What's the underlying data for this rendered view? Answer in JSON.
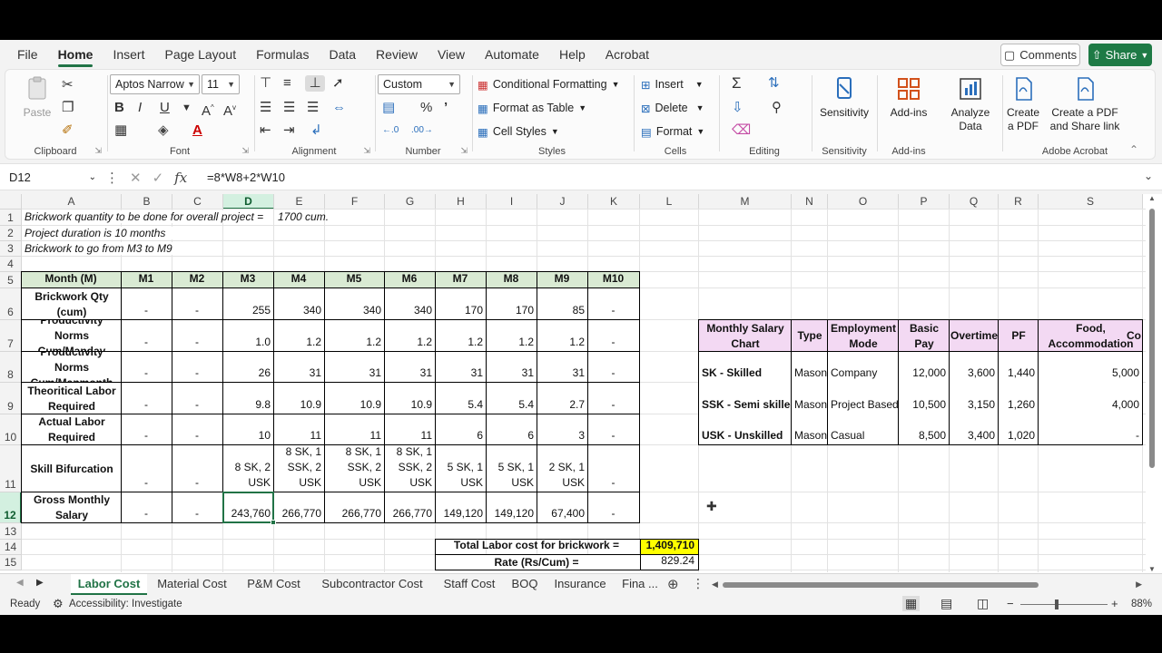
{
  "menu": {
    "items": [
      "File",
      "Home",
      "Insert",
      "Page Layout",
      "Formulas",
      "Data",
      "Review",
      "View",
      "Automate",
      "Help",
      "Acrobat"
    ],
    "active": "Home",
    "comments": "Comments",
    "share": "Share"
  },
  "ribbon": {
    "clipboard": {
      "paste": "Paste",
      "label": "Clipboard"
    },
    "font": {
      "name": "Aptos Narrow",
      "size": "11",
      "label": "Font"
    },
    "alignment": {
      "label": "Alignment"
    },
    "number": {
      "format": "Custom",
      "label": "Number"
    },
    "styles": {
      "conditional": "Conditional Formatting",
      "table": "Format as Table",
      "cell": "Cell Styles",
      "label": "Styles"
    },
    "cells": {
      "insert": "Insert",
      "delete": "Delete",
      "format": "Format",
      "label": "Cells"
    },
    "editing": {
      "label": "Editing"
    },
    "sensitivity": {
      "button": "Sensitivity",
      "label": "Sensitivity"
    },
    "addins": {
      "button": "Add-ins",
      "label": "Add-ins"
    },
    "analyze": {
      "line1": "Analyze",
      "line2": "Data"
    },
    "acrobat": {
      "pdf1": "Create",
      "pdf2": "a PDF",
      "share1": "Create a PDF",
      "share2": "and Share link",
      "label": "Adobe Acrobat"
    }
  },
  "formula_bar": {
    "cell": "D12",
    "formula": "=8*W8+2*W10"
  },
  "columns": [
    "A",
    "B",
    "C",
    "D",
    "E",
    "F",
    "G",
    "H",
    "I",
    "J",
    "K",
    "L",
    "M",
    "N",
    "O",
    "P",
    "Q",
    "R",
    "S"
  ],
  "rows": [
    "1",
    "2",
    "3",
    "4",
    "5",
    "6",
    "7",
    "8",
    "9",
    "10",
    "11",
    "12",
    "13",
    "14",
    "15"
  ],
  "notes": {
    "r1": "Brickwork quantity to be done for overall project =",
    "r1v": "1700 cum.",
    "r2": "Project duration is 10 months",
    "r3": "Brickwork to go from M3 to M9"
  },
  "table": {
    "header": [
      "Month (M)",
      "M1",
      "M2",
      "M3",
      "M4",
      "M5",
      "M6",
      "M7",
      "M8",
      "M9",
      "M10"
    ],
    "rows": [
      {
        "label": "Brickwork Qty (cum)",
        "values": [
          "-",
          "-",
          "255",
          "340",
          "340",
          "340",
          "170",
          "170",
          "85",
          "-"
        ]
      },
      {
        "label": "Productivity Norms Cum/Manday",
        "values": [
          "-",
          "-",
          "1.0",
          "1.2",
          "1.2",
          "1.2",
          "1.2",
          "1.2",
          "1.2",
          "-"
        ]
      },
      {
        "label": "Productivity Norms Cum/Manmonth",
        "values": [
          "-",
          "-",
          "26",
          "31",
          "31",
          "31",
          "31",
          "31",
          "31",
          "-"
        ]
      },
      {
        "label": "Theoritical Labor Required",
        "values": [
          "-",
          "-",
          "9.8",
          "10.9",
          "10.9",
          "10.9",
          "5.4",
          "5.4",
          "2.7",
          "-"
        ]
      },
      {
        "label": "Actual Labor Required",
        "values": [
          "-",
          "-",
          "10",
          "11",
          "11",
          "11",
          "6",
          "6",
          "3",
          "-"
        ]
      },
      {
        "label": "Skill Bifurcation",
        "values": [
          "-",
          "-",
          "8 SK, 2 USK",
          "8 SK, 1 SSK, 2 USK",
          "8 SK, 1 SSK, 2 USK",
          "8 SK, 1 SSK, 2 USK",
          "5 SK, 1 USK",
          "5 SK, 1 USK",
          "2 SK, 1 USK",
          "-"
        ]
      },
      {
        "label": "Gross Monthly Salary",
        "values": [
          "-",
          "-",
          "243,760",
          "266,770",
          "266,770",
          "266,770",
          "149,120",
          "149,120",
          "67,400",
          "-"
        ]
      }
    ]
  },
  "totals": {
    "total_label": "Total Labor cost for brickwork =",
    "total_value": "1,409,710",
    "rate_label": "Rate (Rs/Cum) =",
    "rate_value": "829.24"
  },
  "salary": {
    "header": [
      "Monthly Salary Chart",
      "Type",
      "Employment Mode",
      "Basic Pay",
      "Overtime",
      "PF",
      "Food, Accommodation",
      "Co"
    ],
    "rows": [
      [
        "SK - Skilled",
        "Mason",
        "Company",
        "12,000",
        "3,600",
        "1,440",
        "5,000"
      ],
      [
        "SSK - Semi skilled",
        "Mason",
        "Project Based",
        "10,500",
        "3,150",
        "1,260",
        "4,000"
      ],
      [
        "USK - Unskilled",
        "Mason",
        "Casual",
        "8,500",
        "3,400",
        "1,020",
        "-"
      ]
    ]
  },
  "sheets": [
    "Labor Cost",
    "Material Cost",
    "P&M Cost",
    "Subcontractor Cost",
    "Staff Cost",
    "BOQ",
    "Insurance",
    "Fina ..."
  ],
  "status": {
    "ready": "Ready",
    "accessibility": "Accessibility: Investigate",
    "zoom": "88%"
  },
  "colors": {
    "header_green": "#d9ead3",
    "salary_pink": "#f3d9f3",
    "total_yellow": "#ffff00",
    "accent": "#217346"
  }
}
